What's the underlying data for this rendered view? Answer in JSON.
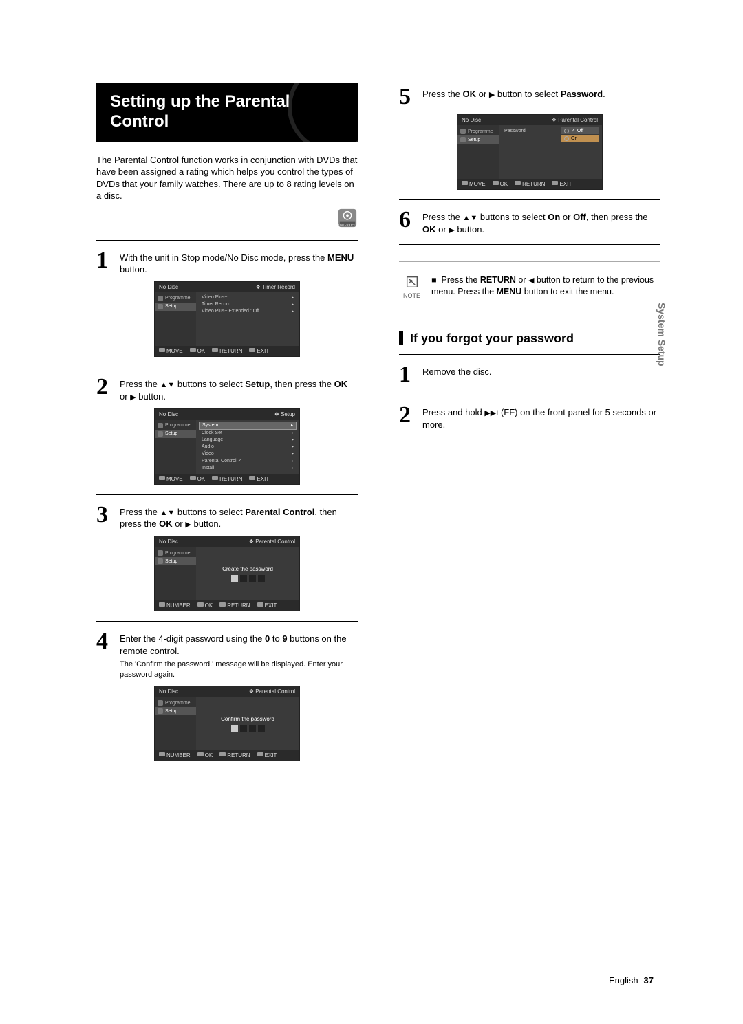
{
  "sideTab": "System Setup",
  "pageFooter": {
    "lang": "English",
    "sep": " -",
    "num": "37"
  },
  "title": "Setting up the Parental Control",
  "intro": "The Parental Control function works in conjunction with DVDs that have been assigned a rating which helps you control the types of DVDs that your family watches. There are up to 8 rating levels on a disc.",
  "dvdIcon": {
    "label": "DVD-VIDEO"
  },
  "steps": {
    "s1": {
      "num": "1",
      "text_a": "With the unit in Stop mode/No Disc mode, press the ",
      "bold": "MENU",
      "text_b": " button."
    },
    "s2": {
      "num": "2",
      "text_a": "Press the ",
      "icon": "▲▼",
      "text_b": " buttons to select ",
      "bold": "Setup",
      "text_c": ", then press the ",
      "bold2": "OK",
      "text_d": " or ",
      "icon2": "▶",
      "text_e": " button."
    },
    "s3": {
      "num": "3",
      "text_a": "Press the ",
      "icon": "▲▼",
      "text_b": " buttons to select ",
      "bold": "Parental Control",
      "text_c": ", then press the ",
      "bold2": "OK",
      "text_d": " or ",
      "icon2": "▶",
      "text_e": " button."
    },
    "s4": {
      "num": "4",
      "text_a": "Enter the 4-digit password using the ",
      "bold": "0",
      "text_b": " to ",
      "bold2": "9",
      "text_c": " buttons on the remote control.",
      "sub": "The 'Confirm the password.' message will be displayed. Enter your password again."
    },
    "s5": {
      "num": "5",
      "text_a": "Press the ",
      "bold": "OK",
      "text_b": " or ",
      "icon": "▶",
      "text_c": " button to select ",
      "bold2": "Password",
      "text_d": "."
    },
    "s6": {
      "num": "6",
      "text_a": "Press the ",
      "icon": "▲▼",
      "text_b": " buttons to select ",
      "bold": "On",
      "text_c": " or ",
      "bold2": "Off",
      "text_d": ", then press the ",
      "bold3": "OK",
      "text_e": " or ",
      "icon2": "▶",
      "text_f": " button."
    }
  },
  "note": {
    "label": "NOTE",
    "bullet": "■",
    "text_a": "Press the ",
    "bold1": "RETURN",
    "text_b": " or ",
    "icon": "◀",
    "text_c": " button to return to the previous menu. Press the ",
    "bold2": "MENU",
    "text_d": " button to exit the menu."
  },
  "forgotHead": "If you forgot your password",
  "forgot": {
    "f1": {
      "num": "1",
      "text": "Remove the disc."
    },
    "f2": {
      "num": "2",
      "text_a": "Press and hold ",
      "icon": "▶▶I",
      "text_b": " (FF) on the front panel for 5 seconds or more."
    }
  },
  "osd": {
    "noDisc": "No Disc",
    "side": {
      "programme": "Programme",
      "setup": "Setup"
    },
    "footers": {
      "move": {
        "a": "MOVE",
        "b": "OK",
        "c": "RETURN",
        "d": "EXIT"
      },
      "number": {
        "a": "NUMBER",
        "b": "OK",
        "c": "RETURN",
        "d": "EXIT"
      }
    },
    "screen1": {
      "crumb": "Timer Record",
      "rows": [
        "Video Plus+",
        "Timer Record",
        "Video Plus+ Extended : Off"
      ]
    },
    "screen2": {
      "crumb": "Setup",
      "rows": [
        "System",
        "Clock Set",
        "Language",
        "Audio",
        "Video",
        "Parental Control",
        "Install"
      ],
      "marks": {
        "5": "✓"
      }
    },
    "screen3": {
      "crumb": "Parental Control",
      "caption": "Create the password"
    },
    "screen4": {
      "crumb": "Parental Control",
      "caption": "Confirm the password"
    },
    "screen5": {
      "crumb": "Parental Control",
      "label": "Password",
      "opts": [
        "Off",
        "On"
      ],
      "marks": {
        "0": "✓"
      }
    }
  }
}
